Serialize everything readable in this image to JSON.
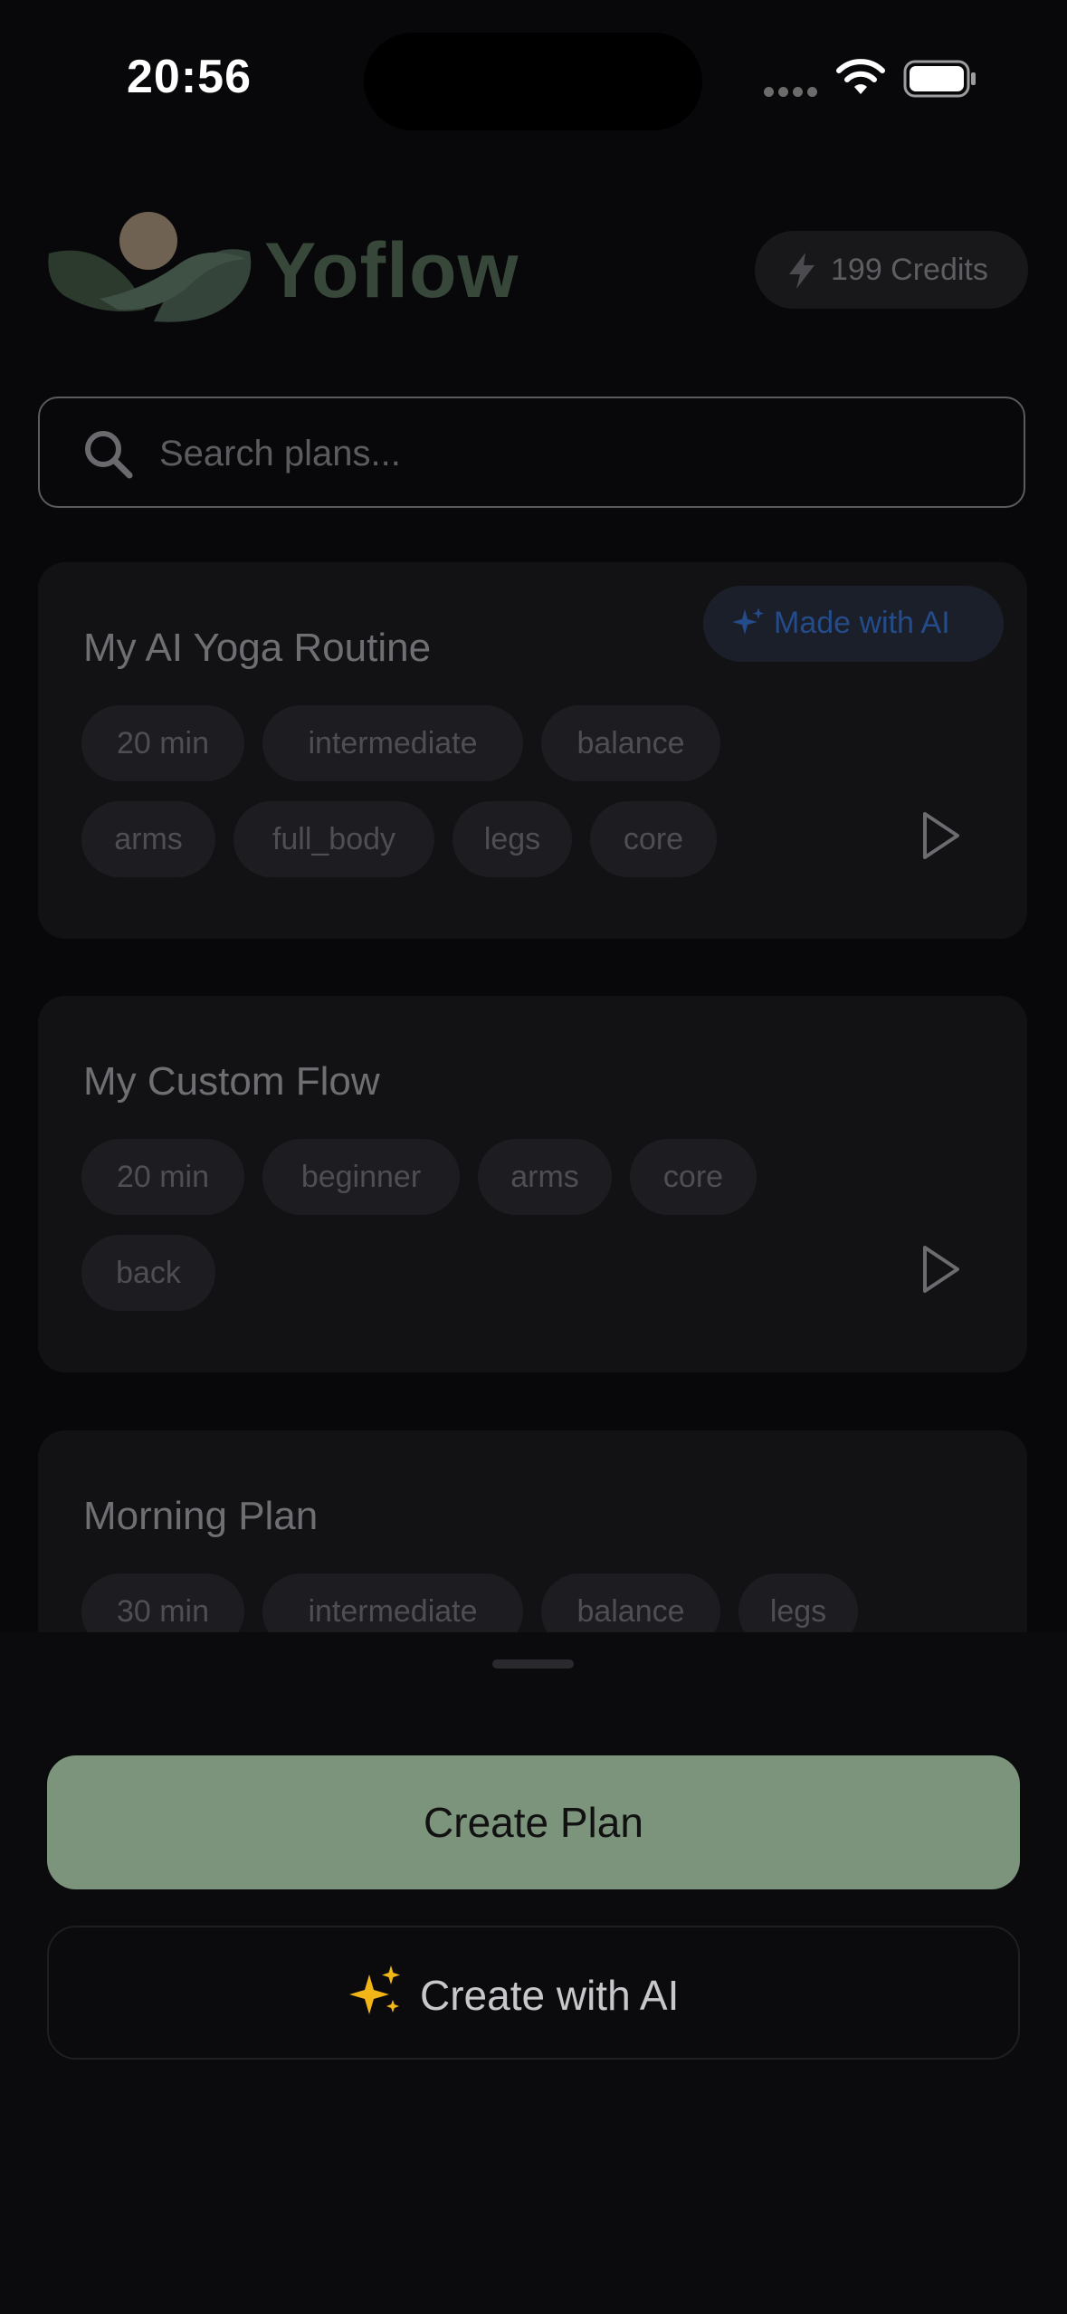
{
  "status": {
    "time": "20:56"
  },
  "header": {
    "brand": "Yoflow",
    "credits": "199 Credits"
  },
  "search": {
    "placeholder": "Search plans..."
  },
  "plans": [
    {
      "title": "My AI Yoga Routine",
      "badge": "Made with AI",
      "tags": [
        "20 min",
        "intermediate",
        "balance",
        "arms",
        "full_body",
        "legs",
        "core"
      ]
    },
    {
      "title": "My Custom Flow",
      "tags": [
        "20 min",
        "beginner",
        "arms",
        "core",
        "back"
      ]
    },
    {
      "title": "Morning Plan",
      "tags": [
        "30 min",
        "intermediate",
        "balance",
        "legs"
      ]
    }
  ],
  "actions": {
    "create_plan": "Create Plan",
    "create_ai": "Create with AI"
  },
  "colors": {
    "accent": "#7c947b",
    "ai_blue": "#244b8a",
    "background": "#08080a"
  },
  "icons": [
    "search-icon",
    "bolt-icon",
    "sparkle-icon",
    "play-icon",
    "wifi-icon",
    "battery-icon"
  ]
}
